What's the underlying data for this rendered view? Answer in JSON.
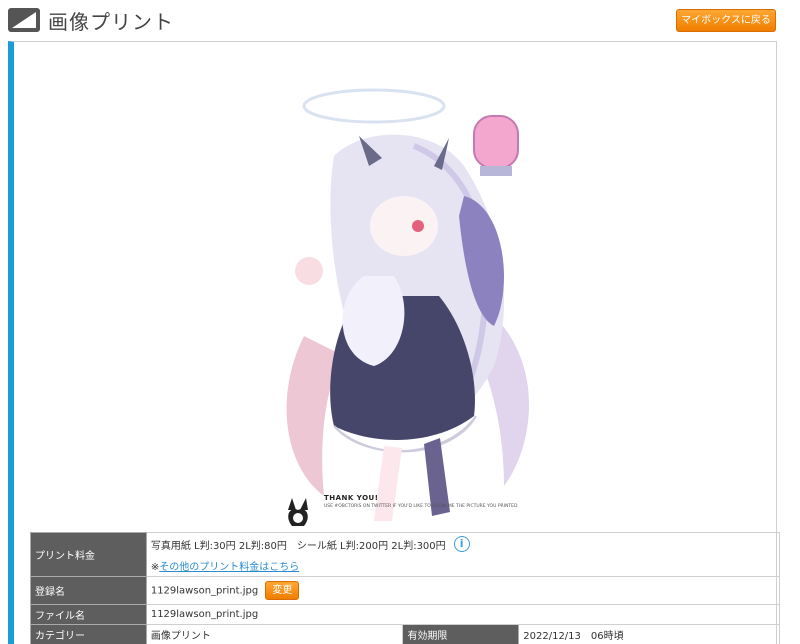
{
  "header": {
    "title": "画像プリント",
    "back_button": "マイボックスに戻る"
  },
  "preview": {
    "thank_title": "THANK YOU!",
    "thank_sub": "USE #OBCTORIS ON TWITTER IF YOU'D LIKE TO SHOW ME THE PICTURE YOU PRINTED"
  },
  "info": {
    "price_label": "プリント料金",
    "price_value": "写真用紙 L判:30円 2L判:80円　シール紙 L判:200円 2L判:300円",
    "price_prefix": "※",
    "price_link": "その他のプリント料金はこちら",
    "reg_label": "登録名",
    "reg_value": "1129lawson_print.jpg",
    "change_button": "変更",
    "file_label": "ファイル名",
    "file_value": "1129lawson_print.jpg",
    "category_label": "カテゴリー",
    "category_value": "画像プリント",
    "expiry_label": "有効期限",
    "expiry_value": "2022/12/13　06時頃"
  },
  "colors": {
    "accent": "#1a9cd8",
    "button": "#f39300",
    "header_cell": "#5e5e5e"
  }
}
